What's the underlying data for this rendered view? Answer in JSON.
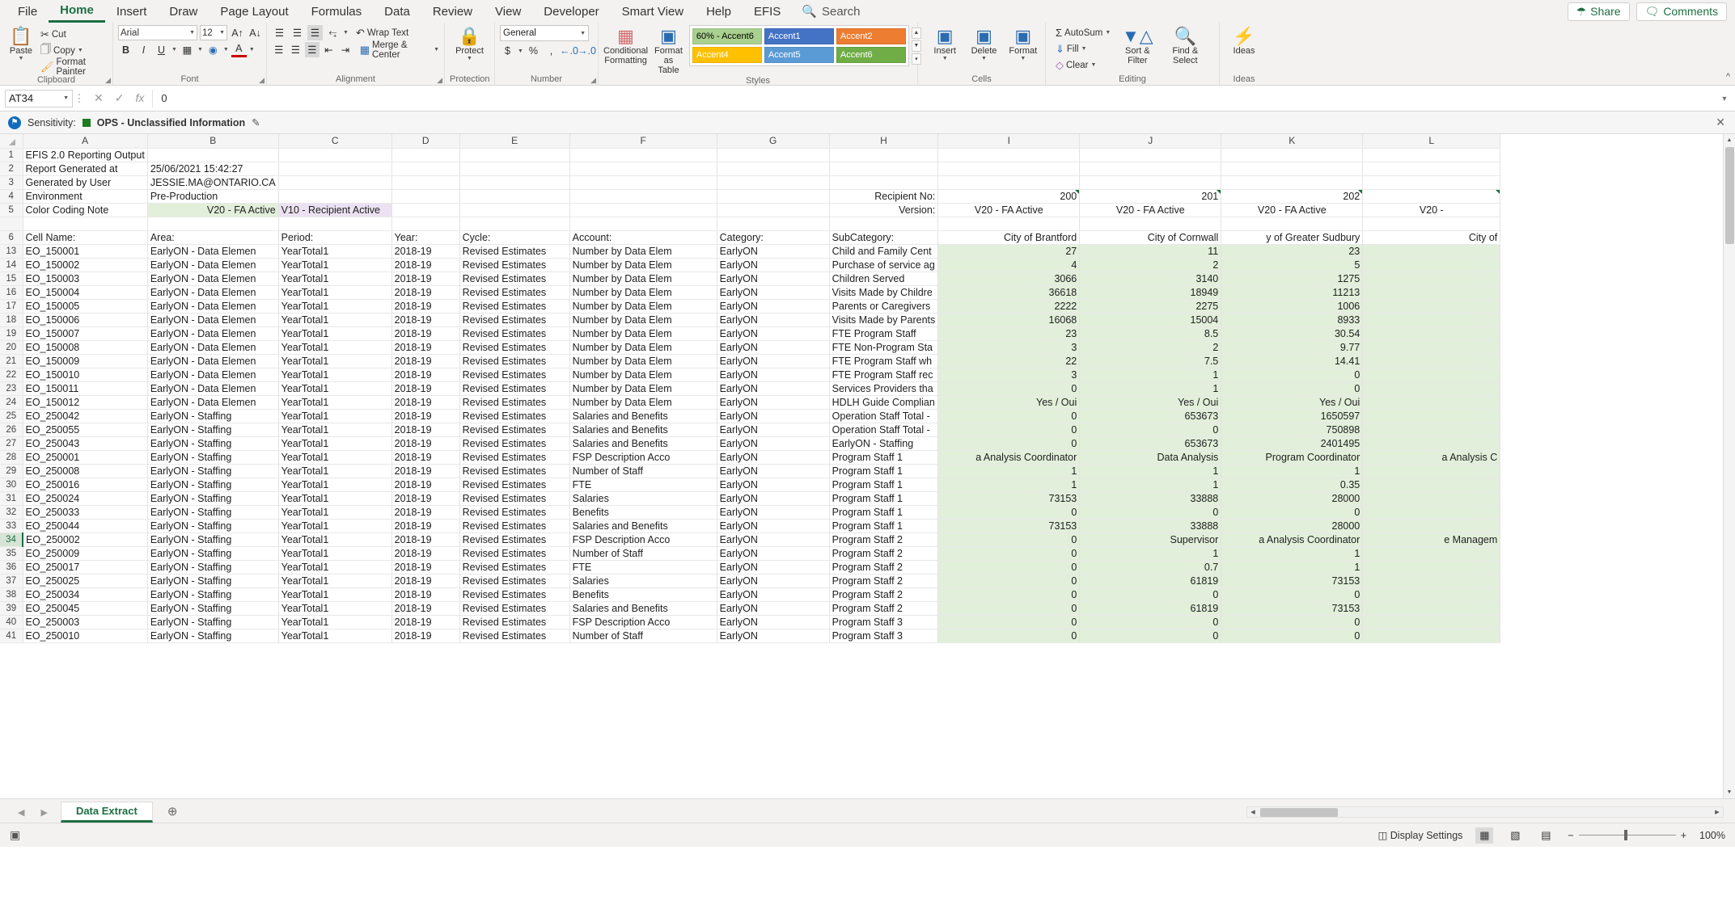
{
  "ribbon": {
    "tabs": [
      "File",
      "Home",
      "Insert",
      "Draw",
      "Page Layout",
      "Formulas",
      "Data",
      "Review",
      "View",
      "Developer",
      "Smart View",
      "Help",
      "EFIS"
    ],
    "active_tab": "Home",
    "search_placeholder": "Search",
    "share_label": "Share",
    "comments_label": "Comments",
    "groups": {
      "clipboard": {
        "label": "Clipboard",
        "paste": "Paste",
        "cut": "Cut",
        "copy": "Copy",
        "format_painter": "Format Painter"
      },
      "font": {
        "label": "Font",
        "font_name": "Arial",
        "font_size": "12",
        "grow": "A",
        "shrink": "A",
        "bold": "B",
        "italic": "I",
        "underline": "U"
      },
      "alignment": {
        "label": "Alignment",
        "wrap_text": "Wrap Text",
        "merge_center": "Merge & Center"
      },
      "protection": {
        "label": "Protection",
        "protect": "Protect"
      },
      "number": {
        "label": "Number",
        "format": "General"
      },
      "styles": {
        "label": "Styles",
        "conditional_formatting": "Conditional Formatting",
        "format_as_table": "Format as Table",
        "gallery": [
          {
            "name": "60% - Accent6",
            "bg": "#a9d08e",
            "fg": "#000000"
          },
          {
            "name": "Accent1",
            "bg": "#4472c4",
            "fg": "#ffffff"
          },
          {
            "name": "Accent2",
            "bg": "#ed7d31",
            "fg": "#ffffff"
          },
          {
            "name": "Accent4",
            "bg": "#ffc000",
            "fg": "#ffffff"
          },
          {
            "name": "Accent5",
            "bg": "#5b9bd5",
            "fg": "#ffffff"
          },
          {
            "name": "Accent6",
            "bg": "#70ad47",
            "fg": "#ffffff"
          }
        ],
        "empty_cell": ""
      },
      "cells": {
        "label": "Cells",
        "insert": "Insert",
        "delete": "Delete",
        "format": "Format"
      },
      "editing": {
        "label": "Editing",
        "autosum": "AutoSum",
        "fill": "Fill",
        "clear": "Clear",
        "sort_filter": "Sort & Filter",
        "find_select": "Find & Select"
      },
      "ideas": {
        "label": "Ideas",
        "ideas": "Ideas"
      }
    }
  },
  "formula_bar": {
    "name_box": "AT34",
    "formula": "0"
  },
  "sensitivity": {
    "label": "Sensitivity:",
    "value": "OPS - Unclassified Information",
    "chip_color": "#1e7b1e"
  },
  "sheet": {
    "columns": [
      "A",
      "B",
      "C",
      "D",
      "E",
      "F",
      "G",
      "H",
      "I",
      "J",
      "K",
      "L"
    ],
    "header_block": [
      {
        "row": "1",
        "a": "EFIS 2.0 Reporting Output",
        "b": ""
      },
      {
        "row": "2",
        "a": "Report Generated at",
        "b": "25/06/2021 15:42:27"
      },
      {
        "row": "3",
        "a": "Generated by User",
        "b": "JESSIE.MA@ONTARIO.CA"
      },
      {
        "row": "4",
        "a": "Environment",
        "b": "Pre-Production"
      },
      {
        "row": "5",
        "a": "Color Coding Note",
        "b": "V20 - FA Active",
        "c": "V10 - Recipient Active"
      }
    ],
    "recipient_row": {
      "label": "Recipient No:",
      "values": [
        "200",
        "201",
        "202",
        ""
      ]
    },
    "version_row": {
      "label": "Version:",
      "values": [
        "V20 - FA Active",
        "V20 - FA Active",
        "V20 - FA Active",
        "V20 -"
      ]
    },
    "column_headers": {
      "row": "6",
      "labels": [
        "Cell Name:",
        "Area:",
        "Period:",
        "Year:",
        "Cycle:",
        "Account:",
        "Category:",
        "SubCategory:"
      ],
      "recipients": [
        "City of Brantford",
        "City of Cornwall",
        "y of Greater Sudbury",
        "City of"
      ]
    },
    "rows": [
      {
        "row": "13",
        "cell_name": "EO_150001",
        "area": "EarlyON - Data Elemen",
        "period": "YearTotal1",
        "year": "2018-19",
        "cycle": "Revised Estimates",
        "account": "Number by Data Elem",
        "category": "EarlyON",
        "subcategory": "Child and Family Cent",
        "v1": "27",
        "v2": "11",
        "v3": "23",
        "v4": ""
      },
      {
        "row": "14",
        "cell_name": "EO_150002",
        "area": "EarlyON - Data Elemen",
        "period": "YearTotal1",
        "year": "2018-19",
        "cycle": "Revised Estimates",
        "account": "Number by Data Elem",
        "category": "EarlyON",
        "subcategory": "Purchase of service ag",
        "v1": "4",
        "v2": "2",
        "v3": "5",
        "v4": ""
      },
      {
        "row": "15",
        "cell_name": "EO_150003",
        "area": "EarlyON - Data Elemen",
        "period": "YearTotal1",
        "year": "2018-19",
        "cycle": "Revised Estimates",
        "account": "Number by Data Elem",
        "category": "EarlyON",
        "subcategory": "Children Served",
        "v1": "3066",
        "v2": "3140",
        "v3": "1275",
        "v4": ""
      },
      {
        "row": "16",
        "cell_name": "EO_150004",
        "area": "EarlyON - Data Elemen",
        "period": "YearTotal1",
        "year": "2018-19",
        "cycle": "Revised Estimates",
        "account": "Number by Data Elem",
        "category": "EarlyON",
        "subcategory": "Visits Made by Childre",
        "v1": "36618",
        "v2": "18949",
        "v3": "11213",
        "v4": ""
      },
      {
        "row": "17",
        "cell_name": "EO_150005",
        "area": "EarlyON - Data Elemen",
        "period": "YearTotal1",
        "year": "2018-19",
        "cycle": "Revised Estimates",
        "account": "Number by Data Elem",
        "category": "EarlyON",
        "subcategory": "Parents or Caregivers",
        "v1": "2222",
        "v2": "2275",
        "v3": "1006",
        "v4": ""
      },
      {
        "row": "18",
        "cell_name": "EO_150006",
        "area": "EarlyON - Data Elemen",
        "period": "YearTotal1",
        "year": "2018-19",
        "cycle": "Revised Estimates",
        "account": "Number by Data Elem",
        "category": "EarlyON",
        "subcategory": "Visits Made by Parents",
        "v1": "16068",
        "v2": "15004",
        "v3": "8933",
        "v4": ""
      },
      {
        "row": "19",
        "cell_name": "EO_150007",
        "area": "EarlyON - Data Elemen",
        "period": "YearTotal1",
        "year": "2018-19",
        "cycle": "Revised Estimates",
        "account": "Number by Data Elem",
        "category": "EarlyON",
        "subcategory": "FTE Program Staff",
        "v1": "23",
        "v2": "8.5",
        "v3": "30.54",
        "v4": ""
      },
      {
        "row": "20",
        "cell_name": "EO_150008",
        "area": "EarlyON - Data Elemen",
        "period": "YearTotal1",
        "year": "2018-19",
        "cycle": "Revised Estimates",
        "account": "Number by Data Elem",
        "category": "EarlyON",
        "subcategory": "FTE Non-Program Sta",
        "v1": "3",
        "v2": "2",
        "v3": "9.77",
        "v4": ""
      },
      {
        "row": "21",
        "cell_name": "EO_150009",
        "area": "EarlyON - Data Elemen",
        "period": "YearTotal1",
        "year": "2018-19",
        "cycle": "Revised Estimates",
        "account": "Number by Data Elem",
        "category": "EarlyON",
        "subcategory": "FTE Program Staff wh",
        "v1": "22",
        "v2": "7.5",
        "v3": "14.41",
        "v4": ""
      },
      {
        "row": "22",
        "cell_name": "EO_150010",
        "area": "EarlyON - Data Elemen",
        "period": "YearTotal1",
        "year": "2018-19",
        "cycle": "Revised Estimates",
        "account": "Number by Data Elem",
        "category": "EarlyON",
        "subcategory": "FTE Program Staff rec",
        "v1": "3",
        "v2": "1",
        "v3": "0",
        "v4": ""
      },
      {
        "row": "23",
        "cell_name": "EO_150011",
        "area": "EarlyON - Data Elemen",
        "period": "YearTotal1",
        "year": "2018-19",
        "cycle": "Revised Estimates",
        "account": "Number by Data Elem",
        "category": "EarlyON",
        "subcategory": "Services Providers tha",
        "v1": "0",
        "v2": "1",
        "v3": "0",
        "v4": ""
      },
      {
        "row": "24",
        "cell_name": "EO_150012",
        "area": "EarlyON - Data Elemen",
        "period": "YearTotal1",
        "year": "2018-19",
        "cycle": "Revised Estimates",
        "account": "Number by Data Elem",
        "category": "EarlyON",
        "subcategory": "HDLH Guide Complian",
        "v1": "Yes / Oui",
        "v2": "Yes / Oui",
        "v3": "Yes / Oui",
        "v4": ""
      },
      {
        "row": "25",
        "cell_name": "EO_250042",
        "area": "EarlyON - Staffing",
        "period": "YearTotal1",
        "year": "2018-19",
        "cycle": "Revised Estimates",
        "account": "Salaries and Benefits",
        "category": "EarlyON",
        "subcategory": "Operation Staff Total -",
        "v1": "0",
        "v2": "653673",
        "v3": "1650597",
        "v4": ""
      },
      {
        "row": "26",
        "cell_name": "EO_250055",
        "area": "EarlyON - Staffing",
        "period": "YearTotal1",
        "year": "2018-19",
        "cycle": "Revised Estimates",
        "account": "Salaries and Benefits",
        "category": "EarlyON",
        "subcategory": "Operation Staff Total -",
        "v1": "0",
        "v2": "0",
        "v3": "750898",
        "v4": ""
      },
      {
        "row": "27",
        "cell_name": "EO_250043",
        "area": "EarlyON - Staffing",
        "period": "YearTotal1",
        "year": "2018-19",
        "cycle": "Revised Estimates",
        "account": "Salaries and Benefits",
        "category": "EarlyON",
        "subcategory": "EarlyON - Staffing",
        "v1": "0",
        "v2": "653673",
        "v3": "2401495",
        "v4": ""
      },
      {
        "row": "28",
        "cell_name": "EO_250001",
        "area": "EarlyON - Staffing",
        "period": "YearTotal1",
        "year": "2018-19",
        "cycle": "Revised Estimates",
        "account": "FSP Description Acco",
        "category": "EarlyON",
        "subcategory": "Program Staff 1",
        "v1": "a Analysis Coordinator",
        "v2": "Data Analysis",
        "v3": "Program Coordinator",
        "v4": "a Analysis C"
      },
      {
        "row": "29",
        "cell_name": "EO_250008",
        "area": "EarlyON - Staffing",
        "period": "YearTotal1",
        "year": "2018-19",
        "cycle": "Revised Estimates",
        "account": "Number of Staff",
        "category": "EarlyON",
        "subcategory": "Program Staff 1",
        "v1": "1",
        "v2": "1",
        "v3": "1",
        "v4": ""
      },
      {
        "row": "30",
        "cell_name": "EO_250016",
        "area": "EarlyON - Staffing",
        "period": "YearTotal1",
        "year": "2018-19",
        "cycle": "Revised Estimates",
        "account": "FTE",
        "category": "EarlyON",
        "subcategory": "Program Staff 1",
        "v1": "1",
        "v2": "1",
        "v3": "0.35",
        "v4": ""
      },
      {
        "row": "31",
        "cell_name": "EO_250024",
        "area": "EarlyON - Staffing",
        "period": "YearTotal1",
        "year": "2018-19",
        "cycle": "Revised Estimates",
        "account": "Salaries",
        "category": "EarlyON",
        "subcategory": "Program Staff 1",
        "v1": "73153",
        "v2": "33888",
        "v3": "28000",
        "v4": ""
      },
      {
        "row": "32",
        "cell_name": "EO_250033",
        "area": "EarlyON - Staffing",
        "period": "YearTotal1",
        "year": "2018-19",
        "cycle": "Revised Estimates",
        "account": "Benefits",
        "category": "EarlyON",
        "subcategory": "Program Staff 1",
        "v1": "0",
        "v2": "0",
        "v3": "0",
        "v4": ""
      },
      {
        "row": "33",
        "cell_name": "EO_250044",
        "area": "EarlyON - Staffing",
        "period": "YearTotal1",
        "year": "2018-19",
        "cycle": "Revised Estimates",
        "account": "Salaries and Benefits",
        "category": "EarlyON",
        "subcategory": "Program Staff 1",
        "v1": "73153",
        "v2": "33888",
        "v3": "28000",
        "v4": ""
      },
      {
        "row": "34",
        "cell_name": "EO_250002",
        "area": "EarlyON - Staffing",
        "period": "YearTotal1",
        "year": "2018-19",
        "cycle": "Revised Estimates",
        "account": "FSP Description Acco",
        "category": "EarlyON",
        "subcategory": "Program Staff 2",
        "v1": "0",
        "v2": "Supervisor",
        "v3": "a Analysis Coordinator",
        "v4": "e Managem",
        "selected": true
      },
      {
        "row": "35",
        "cell_name": "EO_250009",
        "area": "EarlyON - Staffing",
        "period": "YearTotal1",
        "year": "2018-19",
        "cycle": "Revised Estimates",
        "account": "Number of Staff",
        "category": "EarlyON",
        "subcategory": "Program Staff 2",
        "v1": "0",
        "v2": "1",
        "v3": "1",
        "v4": ""
      },
      {
        "row": "36",
        "cell_name": "EO_250017",
        "area": "EarlyON - Staffing",
        "period": "YearTotal1",
        "year": "2018-19",
        "cycle": "Revised Estimates",
        "account": "FTE",
        "category": "EarlyON",
        "subcategory": "Program Staff 2",
        "v1": "0",
        "v2": "0.7",
        "v3": "1",
        "v4": ""
      },
      {
        "row": "37",
        "cell_name": "EO_250025",
        "area": "EarlyON - Staffing",
        "period": "YearTotal1",
        "year": "2018-19",
        "cycle": "Revised Estimates",
        "account": "Salaries",
        "category": "EarlyON",
        "subcategory": "Program Staff 2",
        "v1": "0",
        "v2": "61819",
        "v3": "73153",
        "v4": ""
      },
      {
        "row": "38",
        "cell_name": "EO_250034",
        "area": "EarlyON - Staffing",
        "period": "YearTotal1",
        "year": "2018-19",
        "cycle": "Revised Estimates",
        "account": "Benefits",
        "category": "EarlyON",
        "subcategory": "Program Staff 2",
        "v1": "0",
        "v2": "0",
        "v3": "0",
        "v4": ""
      },
      {
        "row": "39",
        "cell_name": "EO_250045",
        "area": "EarlyON - Staffing",
        "period": "YearTotal1",
        "year": "2018-19",
        "cycle": "Revised Estimates",
        "account": "Salaries and Benefits",
        "category": "EarlyON",
        "subcategory": "Program Staff 2",
        "v1": "0",
        "v2": "61819",
        "v3": "73153",
        "v4": ""
      },
      {
        "row": "40",
        "cell_name": "EO_250003",
        "area": "EarlyON - Staffing",
        "period": "YearTotal1",
        "year": "2018-19",
        "cycle": "Revised Estimates",
        "account": "FSP Description Acco",
        "category": "EarlyON",
        "subcategory": "Program Staff 3",
        "v1": "0",
        "v2": "0",
        "v3": "0",
        "v4": ""
      },
      {
        "row": "41",
        "cell_name": "EO_250010",
        "area": "EarlyON - Staffing",
        "period": "YearTotal1",
        "year": "2018-19",
        "cycle": "Revised Estimates",
        "account": "Number of Staff",
        "category": "EarlyON",
        "subcategory": "Program Staff 3",
        "v1": "0",
        "v2": "0",
        "v3": "0",
        "v4": ""
      }
    ]
  },
  "sheet_tabs": {
    "active": "Data Extract",
    "add_label": "+"
  },
  "status_bar": {
    "display_settings": "Display Settings",
    "zoom": "100%"
  }
}
